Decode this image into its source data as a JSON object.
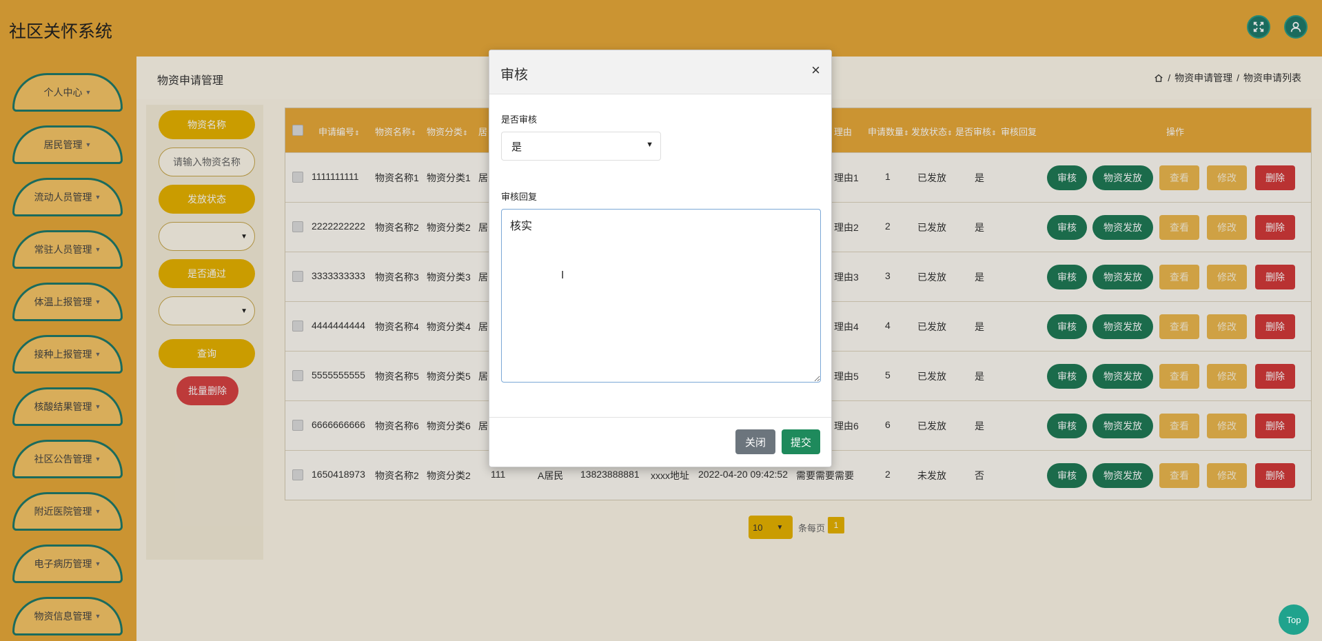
{
  "app": {
    "title": "社区关怀系统"
  },
  "header": {
    "fullscreen_icon": "fullscreen-icon",
    "user_icon": "user-icon"
  },
  "sidebar": {
    "items": [
      {
        "label": "个人中心"
      },
      {
        "label": "居民管理"
      },
      {
        "label": "流动人员管理"
      },
      {
        "label": "常驻人员管理"
      },
      {
        "label": "体温上报管理"
      },
      {
        "label": "接种上报管理"
      },
      {
        "label": "核酸结果管理"
      },
      {
        "label": "社区公告管理"
      },
      {
        "label": "附近医院管理"
      },
      {
        "label": "电子病历管理"
      },
      {
        "label": "物资信息管理"
      }
    ]
  },
  "page": {
    "title": "物资申请管理",
    "breadcrumb": [
      "物资申请管理",
      "物资申请列表"
    ]
  },
  "search": {
    "name_label": "物资名称",
    "name_placeholder": "请输入物资名称",
    "status_label": "发放状态",
    "passed_label": "是否通过",
    "query_button": "查询",
    "batch_delete_button": "批量删除"
  },
  "table": {
    "headers": [
      "申请编号",
      "物资名称",
      "物资分类",
      "居",
      "理由",
      "申请数量",
      "发放状态",
      "是否审核",
      "审核回复",
      "操作"
    ],
    "rows": [
      {
        "id": "1111111111",
        "name": "物资名称1",
        "category": "物资分类1",
        "partial": "居",
        "reason": "理由1",
        "qty": "1",
        "status": "已发放",
        "audited": "是"
      },
      {
        "id": "2222222222",
        "name": "物资名称2",
        "category": "物资分类2",
        "partial": "居",
        "reason": "理由2",
        "qty": "2",
        "status": "已发放",
        "audited": "是"
      },
      {
        "id": "3333333333",
        "name": "物资名称3",
        "category": "物资分类3",
        "partial": "居",
        "reason": "理由3",
        "qty": "3",
        "status": "已发放",
        "audited": "是"
      },
      {
        "id": "4444444444",
        "name": "物资名称4",
        "category": "物资分类4",
        "partial": "居",
        "reason": "理由4",
        "qty": "4",
        "status": "已发放",
        "audited": "是"
      },
      {
        "id": "5555555555",
        "name": "物资名称5",
        "category": "物资分类5",
        "partial": "居",
        "reason": "理由5",
        "qty": "5",
        "status": "已发放",
        "audited": "是"
      },
      {
        "id": "6666666666",
        "name": "物资名称6",
        "category": "物资分类6",
        "partial": "居",
        "reason": "理由6",
        "qty": "6",
        "status": "已发放",
        "audited": "是"
      },
      {
        "id": "1650418973",
        "name": "物资名称2",
        "category": "物资分类2",
        "col4": "111",
        "resident": "A居民",
        "phone": "13823888881",
        "address": "xxxx地址",
        "time": "2022-04-20 09:42:52",
        "reason": "需要需要需要",
        "qty": "2",
        "status": "未发放",
        "audited": "否"
      }
    ],
    "actions": {
      "audit": "审核",
      "distribute": "物资发放",
      "view": "查看",
      "edit": "修改",
      "delete": "删除"
    }
  },
  "pagination": {
    "page_size": "10",
    "per_page_label": "条每页",
    "current_page": "1"
  },
  "modal": {
    "title": "审核",
    "close_symbol": "×",
    "approve_label": "是否审核",
    "approve_value": "是",
    "reply_label": "审核回复",
    "reply_value": "核实",
    "close_button": "关闭",
    "submit_button": "提交"
  },
  "misc": {
    "top_button": "Top"
  }
}
